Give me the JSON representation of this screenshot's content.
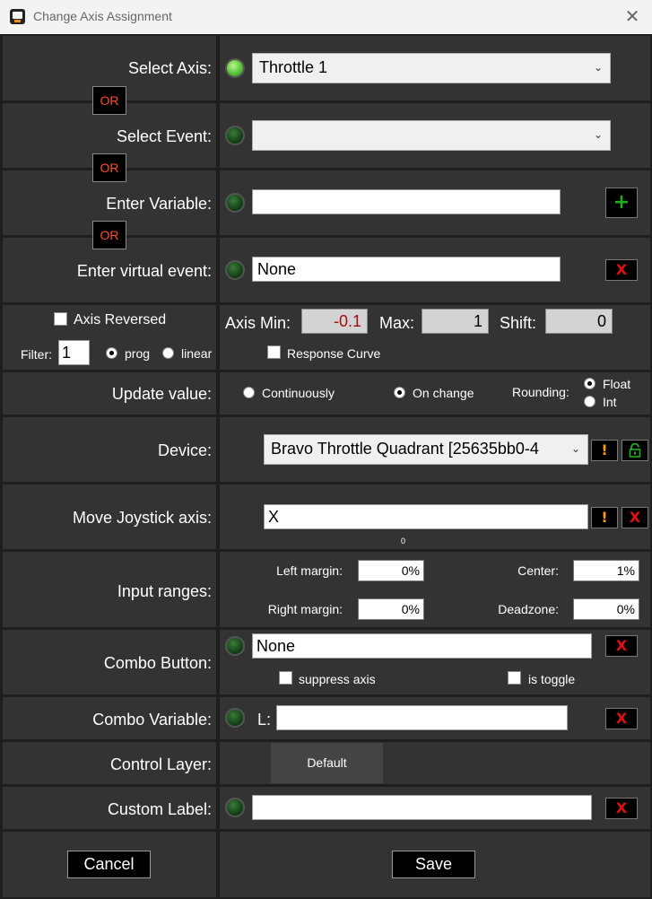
{
  "window": {
    "title": "Change Axis Assignment",
    "close_glyph": "✕",
    "icon": "app-icon"
  },
  "select_axis": {
    "label": "Select Axis:",
    "value": "Throttle 1",
    "led_on": true
  },
  "or_label": "OR",
  "select_event": {
    "label": "Select Event:",
    "value": ""
  },
  "enter_variable": {
    "label": "Enter Variable:",
    "value": "",
    "add_glyph": "+"
  },
  "virtual_event": {
    "label": "Enter virtual event:",
    "value": "None",
    "clear_glyph": "X"
  },
  "options": {
    "axis_reversed": "Axis Reversed",
    "filter_label": "Filter:",
    "filter_value": "1",
    "prog": "prog",
    "linear": "linear",
    "axis_min_label": "Axis Min:",
    "axis_min": "-0.1",
    "max_label": "Max:",
    "max": "1",
    "shift_label": "Shift:",
    "shift": "0",
    "response_curve": "Response Curve"
  },
  "update_value": {
    "label": "Update value:",
    "continuously": "Continuously",
    "on_change": "On change",
    "rounding_label": "Rounding:",
    "float": "Float",
    "int": "Int"
  },
  "device": {
    "label": "Device:",
    "value": "Bravo Throttle Quadrant [25635bb0-4",
    "warn_glyph": "!"
  },
  "move_joystick": {
    "label": "Move Joystick axis:",
    "value": "X",
    "readout": "0",
    "warn_glyph": "!",
    "clear_glyph": "X"
  },
  "input_ranges": {
    "label": "Input ranges:",
    "left_margin_label": "Left margin:",
    "left_margin": "0%",
    "center_label": "Center:",
    "center": "1%",
    "right_margin_label": "Right margin:",
    "right_margin": "0%",
    "deadzone_label": "Deadzone:",
    "deadzone": "0%"
  },
  "combo_button": {
    "label": "Combo Button:",
    "value": "None",
    "suppress_axis": "suppress axis",
    "is_toggle": "is toggle",
    "clear_glyph": "X"
  },
  "combo_variable": {
    "label": "Combo Variable:",
    "prefix": "L:",
    "value": "",
    "clear_glyph": "X"
  },
  "control_layer": {
    "label": "Control Layer:",
    "button": "Default"
  },
  "custom_label": {
    "label": "Custom Label:",
    "value": "",
    "clear_glyph": "X"
  },
  "footer": {
    "cancel": "Cancel",
    "save": "Save"
  },
  "colors": {
    "led_green": "#58c438",
    "or_text": "#ff4d2a",
    "clear_red": "#e01010",
    "warn_orange": "#ff9c00",
    "add_green": "#1fb01f",
    "lock_green": "#1fb01f"
  }
}
